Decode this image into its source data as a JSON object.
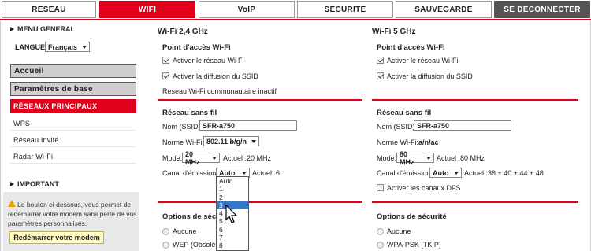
{
  "nav": {
    "tabs": [
      {
        "label": "RESEAU"
      },
      {
        "label": "WIFI"
      },
      {
        "label": "VoIP"
      },
      {
        "label": "SECURITE"
      },
      {
        "label": "SAUVEGARDE"
      },
      {
        "label": "SE DECONNECTER"
      }
    ],
    "active_tab": "WIFI"
  },
  "sidebar": {
    "menu_general": "MENU GENERAL",
    "langue_label": "LANGUE",
    "langue_value": "Français",
    "items": [
      {
        "label": "Accueil"
      },
      {
        "label": "Paramètres de base"
      },
      {
        "label": "RÉSEAUX PRINCIPAUX"
      },
      {
        "label": "WPS"
      },
      {
        "label": "Réseau Invité"
      },
      {
        "label": "Radar Wi-Fi"
      }
    ],
    "important": "IMPORTANT",
    "note": "Le bouton ci-dessous, vous permet de redémarrer votre modem sans perte de vos paramètres personnalisés.",
    "restart_button": "Redémarrer votre modem"
  },
  "wifi24": {
    "title": "Wi-Fi 2,4 GHz",
    "point_acces": "Point d'accès Wi-Fi",
    "activer_reseau": "Activer le réseau Wi-Fi",
    "activer_ssid": "Activer la diffusion du SSID",
    "communautaire": "Reseau Wi-Fi communautaire inactif",
    "reseau_sans_fil": "Réseau sans fil",
    "nom_label": "Nom (SSID):",
    "nom_value": "SFR-a750",
    "norme_label": "Norme Wi-Fi:",
    "norme_value": "802.11 b/g/n",
    "mode_label": "Mode:",
    "mode_value": "20 MHz",
    "mode_actuel": "Actuel :20 MHz",
    "canal_label": "Canal d'émission:",
    "canal_value": "Auto",
    "canal_actuel": "Actuel :6",
    "options_securite": "Options de sécurité",
    "aucune": "Aucune",
    "wep": "WEP (Obsolète)",
    "canal_options": [
      "Auto",
      "1",
      "2",
      "3",
      "4",
      "5",
      "6",
      "7",
      "8"
    ],
    "canal_highlighted": "3"
  },
  "wifi5": {
    "title": "Wi-Fi 5 GHz",
    "point_acces": "Point d'accès Wi-Fi",
    "activer_reseau": "Activer le réseau Wi-Fi",
    "activer_ssid": "Activer la diffusion du SSID",
    "reseau_sans_fil": "Réseau sans fil",
    "nom_label": "Nom (SSID):",
    "nom_value": "SFR-a750",
    "norme_label": "Norme Wi-Fi:",
    "norme_value": "a/n/ac",
    "mode_label": "Mode:",
    "mode_value": "80 MHz",
    "mode_actuel": "Actuel :80 MHz",
    "canal_label": "Canal d'émission:",
    "canal_value": "Auto",
    "canal_actuel": "Actuel :36 + 40 + 44 + 48",
    "dfs": "Activer les canaux DFS",
    "options_securite": "Options de sécurité",
    "aucune": "Aucune",
    "wpa": "WPA-PSK [TKIP]"
  },
  "colors": {
    "accent": "#e0001b",
    "dark_tab": "#555555",
    "highlight": "#3a76c8"
  }
}
